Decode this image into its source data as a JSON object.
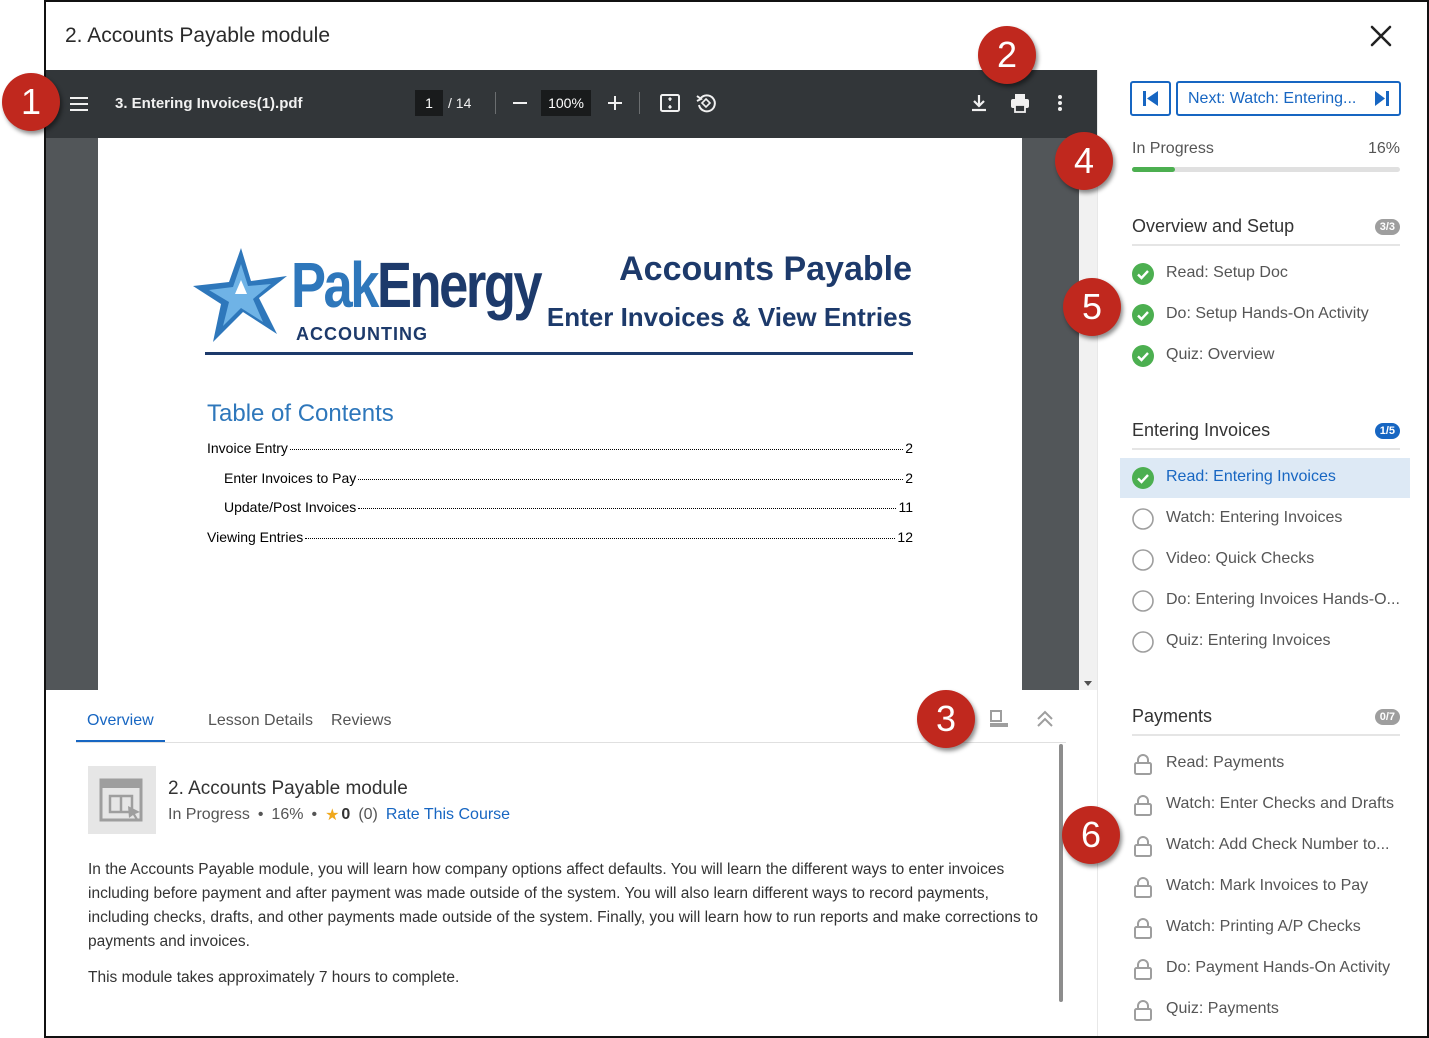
{
  "modal": {
    "title": "2. Accounts Payable module"
  },
  "pdf_toolbar": {
    "file_name": "3. Entering Invoices(1).pdf",
    "page_current": "1",
    "page_total": "/ 14",
    "zoom": "100%",
    "icons": [
      "menu-icon",
      "zoom-out-icon",
      "zoom-in-icon",
      "fit-page-icon",
      "rotate-icon",
      "download-icon",
      "print-icon",
      "more-icon"
    ]
  },
  "pdf_page": {
    "brand_light": "Pak",
    "brand_dark": "Energy",
    "brand_sub": "ACCOUNTING",
    "title": "Accounts Payable",
    "subtitle": "Enter Invoices & View Entries",
    "toc_title": "Table of Contents",
    "toc": [
      {
        "label": "Invoice Entry",
        "page": "2"
      },
      {
        "label": "Enter Invoices to Pay",
        "page": "2"
      },
      {
        "label": "Update/Post Invoices",
        "page": "11"
      },
      {
        "label": "Viewing Entries",
        "page": "12"
      }
    ]
  },
  "tabs": [
    {
      "label": "Overview",
      "active": true
    },
    {
      "label": "Lesson Details",
      "active": false
    },
    {
      "label": "Reviews",
      "active": false
    }
  ],
  "overview": {
    "course_name": "2. Accounts Payable module",
    "status": "In Progress",
    "percent": "16%",
    "rating": "0",
    "rating_count": "(0)",
    "rate_link": "Rate This Course",
    "description": "In the Accounts Payable module, you will learn how company options affect defaults. You will learn the different ways to enter invoices including before payment and after payment was made outside of the system. You will also learn different ways to record payments, including checks, drafts, and other payments made outside of the system. Finally, you will learn how to run reports and make corrections to payments and invoices.",
    "duration_note": "This module takes approximately 7 hours to complete."
  },
  "sidebar": {
    "next_label": "Next: Watch: Entering...",
    "progress_label": "In Progress",
    "progress_pct": "16%",
    "progress_value": 0.16,
    "sections": [
      {
        "title": "Overview and Setup",
        "badge": "3/3",
        "items": [
          {
            "label": "Read: Setup Doc",
            "state": "done"
          },
          {
            "label": "Do: Setup Hands-On Activity",
            "state": "done"
          },
          {
            "label": "Quiz: Overview",
            "state": "done"
          }
        ]
      },
      {
        "title": "Entering Invoices",
        "badge": "1/5",
        "items": [
          {
            "label": "Read: Entering Invoices",
            "state": "done"
          },
          {
            "label": "Watch: Entering Invoices",
            "state": "todo"
          },
          {
            "label": "Video: Quick Checks",
            "state": "todo"
          },
          {
            "label": "Do: Entering Invoices Hands-O...",
            "state": "todo"
          },
          {
            "label": "Quiz: Entering Invoices",
            "state": "todo"
          }
        ]
      },
      {
        "title": "Payments",
        "badge": "0/7",
        "items": [
          {
            "label": "Read: Payments",
            "state": "locked"
          },
          {
            "label": "Watch: Enter Checks and Drafts",
            "state": "locked"
          },
          {
            "label": "Watch: Add Check Number to...",
            "state": "locked"
          },
          {
            "label": "Watch: Mark Invoices to Pay",
            "state": "locked"
          },
          {
            "label": "Watch: Printing A/P Checks",
            "state": "locked"
          },
          {
            "label": "Do: Payment Hands-On Activity",
            "state": "locked"
          },
          {
            "label": "Quiz: Payments",
            "state": "locked"
          }
        ]
      }
    ]
  },
  "callouts": [
    "1",
    "2",
    "3",
    "4",
    "5",
    "6"
  ],
  "colors": {
    "accent": "#1766c2",
    "success": "#4caf50",
    "callout": "#c0281e",
    "toolbar": "#323639"
  }
}
